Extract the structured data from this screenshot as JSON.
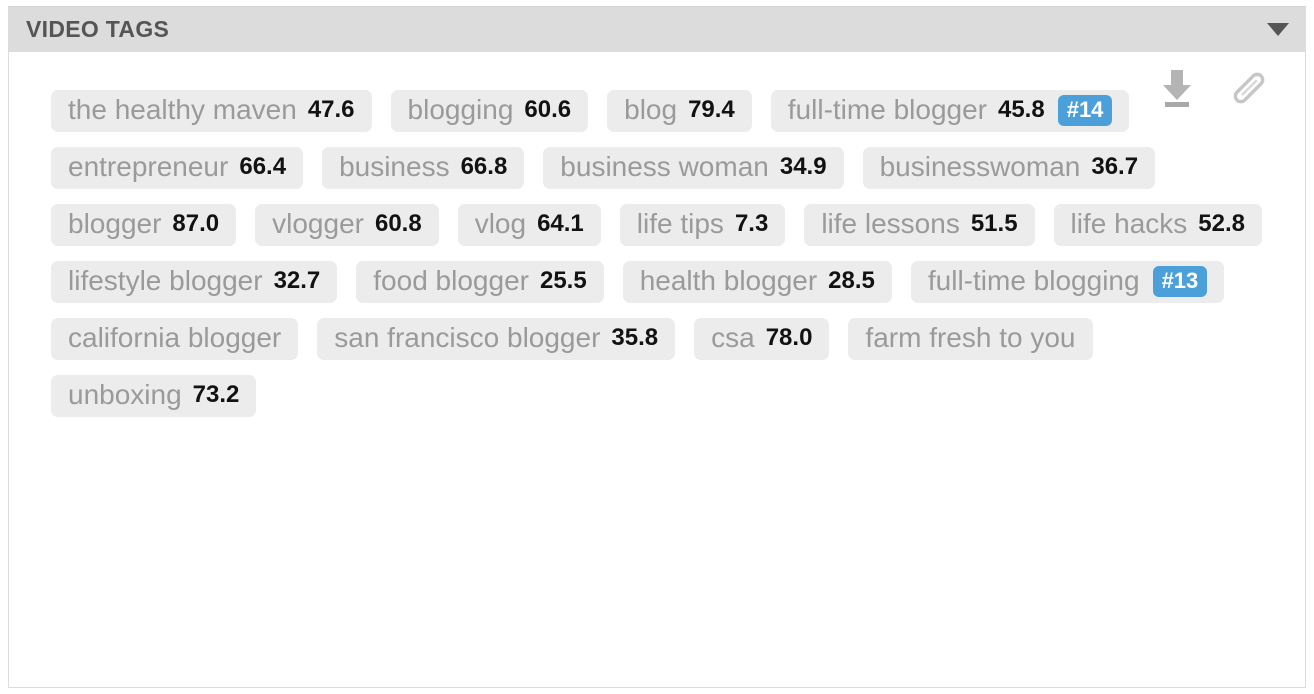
{
  "panel": {
    "title": "VIDEO TAGS",
    "collapse_icon": "chevron-down-icon",
    "expanded": true
  },
  "actions": [
    {
      "name": "download-icon",
      "label": "Download"
    },
    {
      "name": "paperclip-icon",
      "label": "Attach"
    }
  ],
  "colors": {
    "panel_header_bg": "#dcdcdc",
    "panel_title_text": "#555555",
    "tag_bg": "#ececec",
    "tag_label_text": "#9a9a9a",
    "tag_score_text": "#121212",
    "rank_badge_bg": "#4ba0da",
    "rank_badge_text": "#ffffff",
    "panel_border": "#dcdcdc"
  },
  "tags": [
    {
      "label": "the healthy maven",
      "score": "47.6",
      "rank": ""
    },
    {
      "label": "blogging",
      "score": "60.6",
      "rank": ""
    },
    {
      "label": "blog",
      "score": "79.4",
      "rank": ""
    },
    {
      "label": "full-time blogger",
      "score": "45.8",
      "rank": "#14"
    },
    {
      "label": "entrepreneur",
      "score": "66.4",
      "rank": ""
    },
    {
      "label": "business",
      "score": "66.8",
      "rank": ""
    },
    {
      "label": "business woman",
      "score": "34.9",
      "rank": ""
    },
    {
      "label": "businesswoman",
      "score": "36.7",
      "rank": ""
    },
    {
      "label": "blogger",
      "score": "87.0",
      "rank": ""
    },
    {
      "label": "vlogger",
      "score": "60.8",
      "rank": ""
    },
    {
      "label": "vlog",
      "score": "64.1",
      "rank": ""
    },
    {
      "label": "life tips",
      "score": "7.3",
      "rank": ""
    },
    {
      "label": "life lessons",
      "score": "51.5",
      "rank": ""
    },
    {
      "label": "life hacks",
      "score": "52.8",
      "rank": ""
    },
    {
      "label": "lifestyle blogger",
      "score": "32.7",
      "rank": ""
    },
    {
      "label": "food blogger",
      "score": "25.5",
      "rank": ""
    },
    {
      "label": "health blogger",
      "score": "28.5",
      "rank": ""
    },
    {
      "label": "full-time blogging",
      "score": "",
      "rank": "#13"
    },
    {
      "label": "california blogger",
      "score": "",
      "rank": ""
    },
    {
      "label": "san francisco blogger",
      "score": "35.8",
      "rank": ""
    },
    {
      "label": "csa",
      "score": "78.0",
      "rank": ""
    },
    {
      "label": "farm fresh to you",
      "score": "",
      "rank": ""
    },
    {
      "label": "unboxing",
      "score": "73.2",
      "rank": ""
    }
  ]
}
